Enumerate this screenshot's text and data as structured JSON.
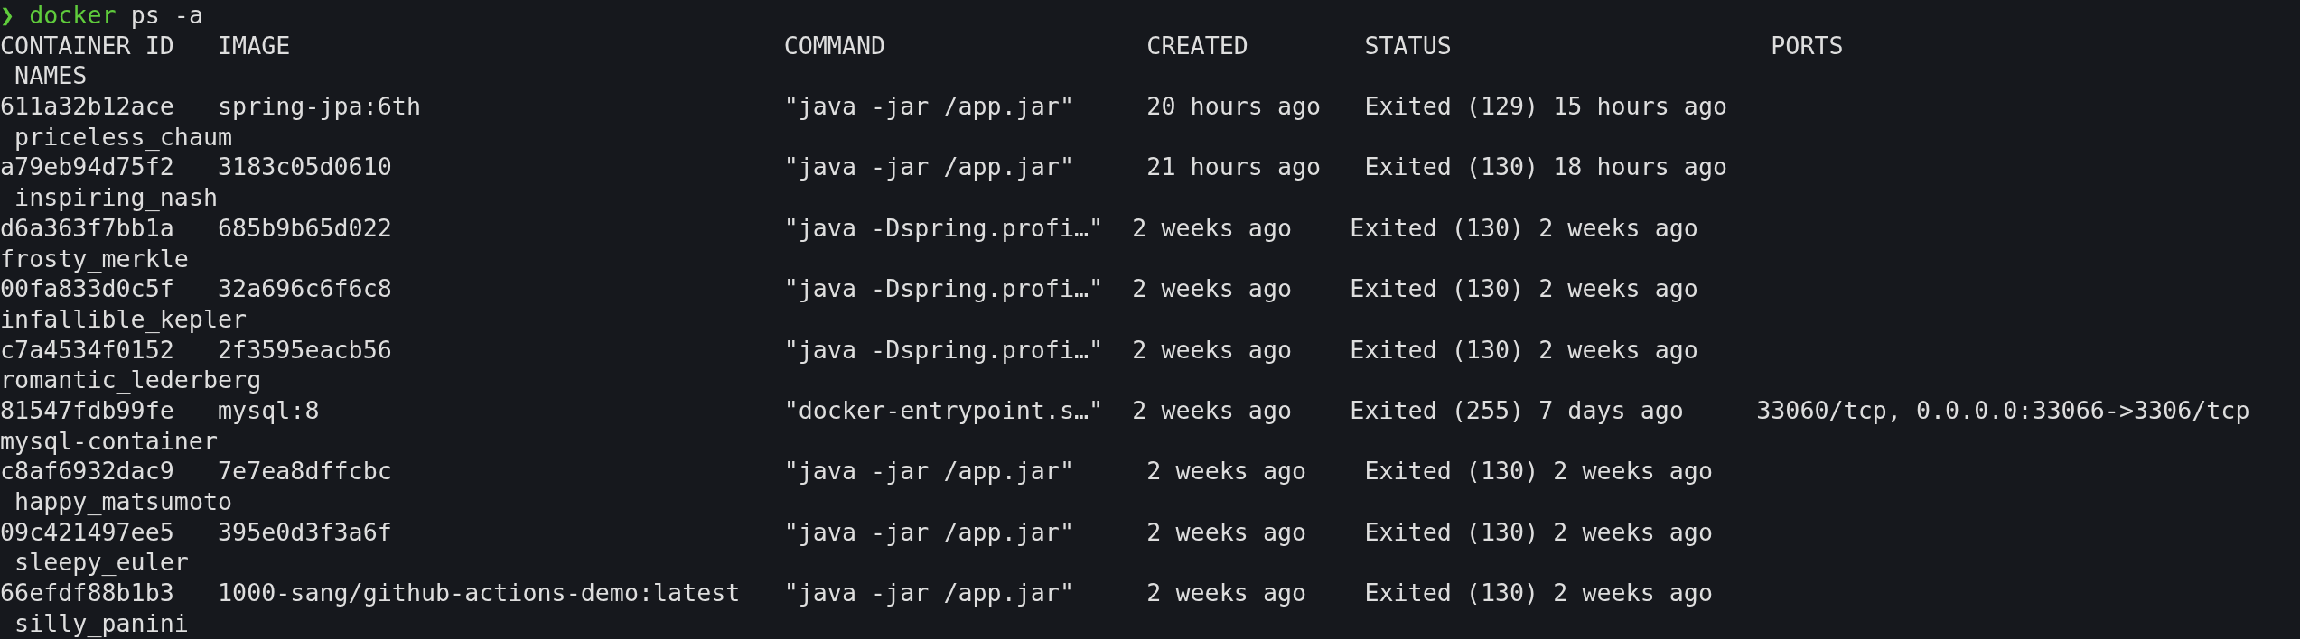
{
  "prompt": {
    "symbol": "❯",
    "command": "docker",
    "args": "ps -a"
  },
  "table": {
    "columns": [
      "CONTAINER ID",
      "IMAGE",
      "COMMAND",
      "CREATED",
      "STATUS",
      "PORTS",
      "NAMES"
    ],
    "rows": [
      {
        "container_id": "611a32b12ace",
        "image": "spring-jpa:6th",
        "command": "\"java -jar /app.jar\"",
        "created": "20 hours ago",
        "status": "Exited (129) 15 hours ago",
        "names": "priceless_chaum"
      },
      {
        "container_id": "a79eb94d75f2",
        "image": "3183c05d0610",
        "command": "\"java -jar /app.jar\"",
        "created": "21 hours ago",
        "status": "Exited (130) 18 hours ago",
        "names": "inspiring_nash"
      },
      {
        "container_id": "d6a363f7bb1a",
        "image": "685b9b65d022",
        "command": "\"java -Dspring.profi…\"",
        "created": "2 weeks ago",
        "status": "Exited (130) 2 weeks ago",
        "names": "frosty_merkle"
      },
      {
        "container_id": "00fa833d0c5f",
        "image": "32a696c6f6c8",
        "command": "\"java -Dspring.profi…\"",
        "created": "2 weeks ago",
        "status": "Exited (130) 2 weeks ago",
        "names": "infallible_kepler"
      },
      {
        "container_id": "c7a4534f0152",
        "image": "2f3595eacb56",
        "command": "\"java -Dspring.profi…\"",
        "created": "2 weeks ago",
        "status": "Exited (130) 2 weeks ago",
        "names": "romantic_lederberg"
      },
      {
        "container_id": "81547fdb99fe",
        "image": "mysql:8",
        "command": "\"docker-entrypoint.s…\"",
        "created": "2 weeks ago",
        "status": "Exited (255) 7 days ago",
        "ports": "33060/tcp, 0.0.0.0:33066->3306/tcp",
        "names": "mysql-container"
      },
      {
        "container_id": "c8af6932dac9",
        "image": "7e7ea8dffcbc",
        "command": "\"java -jar /app.jar\"",
        "created": "2 weeks ago",
        "status": "Exited (130) 2 weeks ago",
        "names": "happy_matsumoto"
      },
      {
        "container_id": "09c421497ee5",
        "image": "395e0d3f3a6f",
        "command": "\"java -jar /app.jar\"",
        "created": "2 weeks ago",
        "status": "Exited (130) 2 weeks ago",
        "names": "sleepy_euler"
      },
      {
        "container_id": "66efdf88b1b3",
        "image": "1000-sang/github-actions-demo:latest",
        "command": "\"java -jar /app.jar\"",
        "created": "2 weeks ago",
        "status": "Exited (130) 2 weeks ago",
        "names": "silly_panini"
      }
    ]
  }
}
